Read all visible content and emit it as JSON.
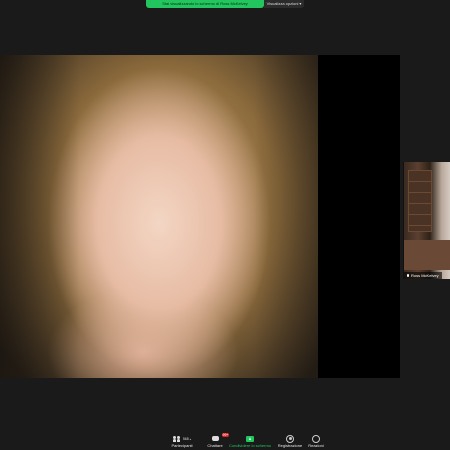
{
  "banner": {
    "share_text": "Stai visualizzando lo schermo di Ross McKelvey",
    "view_options_label": "Visualizza opzioni"
  },
  "video": {
    "participant_name": "Ross McKelvey"
  },
  "toolbar": {
    "participants_label": "Partecipanti",
    "participants_count": "568",
    "chat_label": "Chattare",
    "chat_badge": "99+",
    "share_label": "Condividere lo schermo",
    "record_label": "Registrazione",
    "reactions_label": "Reazioni"
  },
  "colors": {
    "banner_green": "#22c55e",
    "chat_badge_red": "#e02424",
    "background": "#1a1a1a"
  }
}
